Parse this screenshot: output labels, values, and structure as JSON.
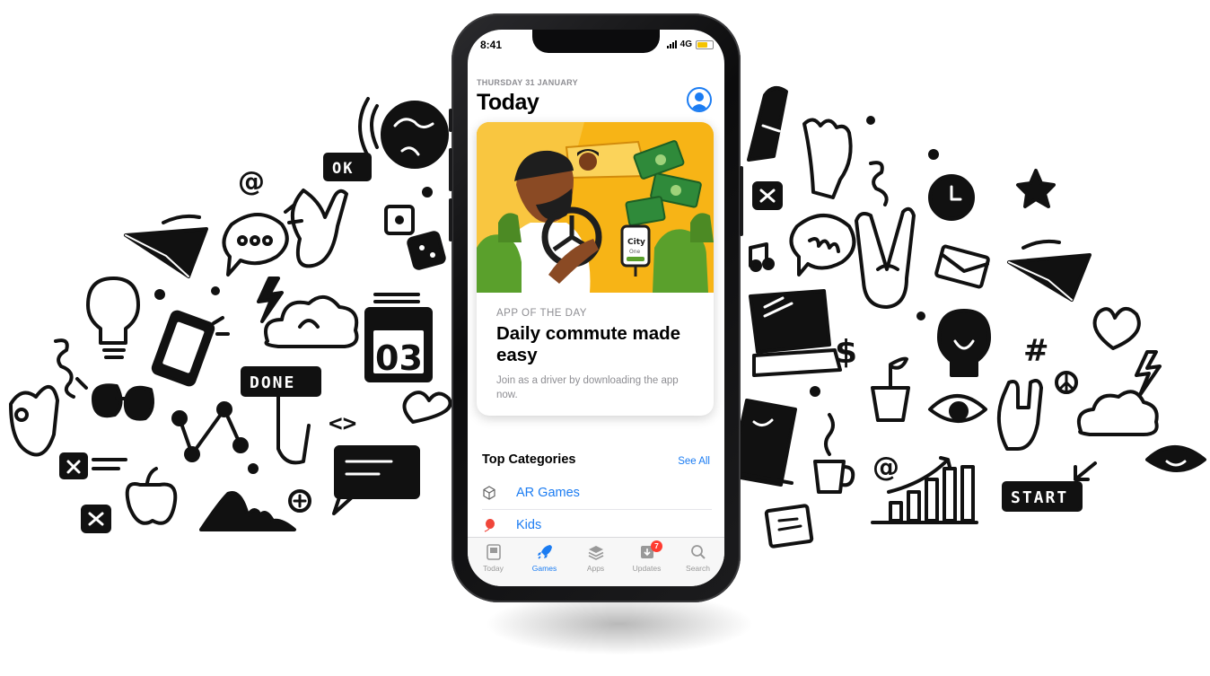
{
  "status_bar": {
    "time": "8:41",
    "network": "4G"
  },
  "header": {
    "date": "THURSDAY 31 JANUARY",
    "title": "Today"
  },
  "feature_card": {
    "kicker": "APP OF THE DAY",
    "title": "Daily commute made easy",
    "description": "Join as a driver by downloading the app now.",
    "art_phone_label_1": "City",
    "art_phone_label_2": "One"
  },
  "categories": {
    "heading": "Top Categories",
    "see_all": "See All",
    "items": [
      {
        "label": "AR Games",
        "icon": "cube-icon"
      },
      {
        "label": "Kids",
        "icon": "balloon-icon"
      }
    ]
  },
  "tab_bar": {
    "active": "Games",
    "tabs": [
      {
        "label": "Today",
        "icon": "today-icon"
      },
      {
        "label": "Games",
        "icon": "rocket-icon"
      },
      {
        "label": "Apps",
        "icon": "layers-icon"
      },
      {
        "label": "Updates",
        "icon": "download-icon",
        "badge": "7"
      },
      {
        "label": "Search",
        "icon": "search-icon"
      }
    ]
  },
  "doodle_labels": {
    "ok": "OK",
    "done": "DONE",
    "start": "START",
    "counter": "03"
  },
  "colors": {
    "accent": "#1b7cf2",
    "badge": "#ff3b30",
    "card_background": "#f7b416",
    "seat_green": "#5aa02c"
  }
}
